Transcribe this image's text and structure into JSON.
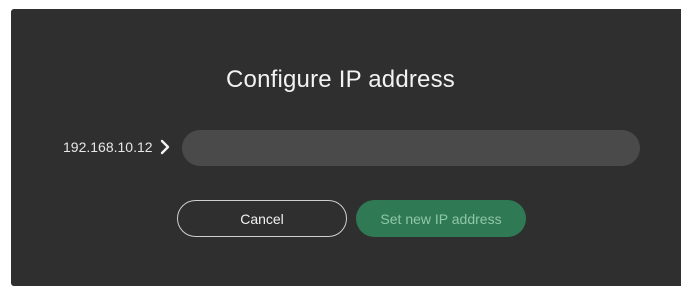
{
  "dialog": {
    "title": "Configure IP address",
    "current_ip": "192.168.10.12",
    "chevron_icon": "chevron-right-icon",
    "new_ip_input": {
      "value": "",
      "placeholder": ""
    },
    "cancel_label": "Cancel",
    "set_label": "Set new IP address"
  },
  "colors": {
    "background": "#2f2f2f",
    "input_bg": "#4a4a4a",
    "primary_button": "#2f7a55",
    "primary_button_text": "#8fc7a8"
  }
}
